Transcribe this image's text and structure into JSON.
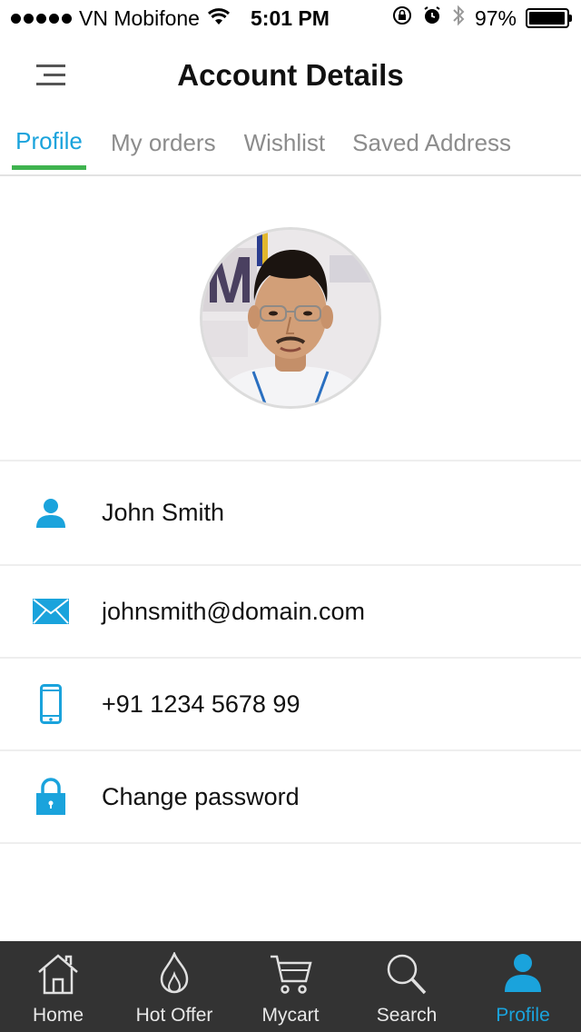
{
  "status_bar": {
    "carrier": "VN Mobifone",
    "time": "5:01 PM",
    "battery": "97%",
    "battery_level": 0.97
  },
  "header": {
    "title": "Account Details"
  },
  "tabs": [
    {
      "label": "Profile",
      "active": true
    },
    {
      "label": "My orders",
      "active": false
    },
    {
      "label": "Wishlist",
      "active": false
    },
    {
      "label": "Saved Address",
      "active": false
    }
  ],
  "profile": {
    "name": "John Smith",
    "email": "johnsmith@domain.com",
    "phone": "+91 1234 5678 99",
    "change_password": "Change password"
  },
  "bottom_nav": [
    {
      "label": "Home",
      "icon": "home-icon",
      "active": false
    },
    {
      "label": "Hot Offer",
      "icon": "flame-icon",
      "active": false
    },
    {
      "label": "Mycart",
      "icon": "cart-icon",
      "active": false
    },
    {
      "label": "Search",
      "icon": "search-icon",
      "active": false
    },
    {
      "label": "Profile",
      "icon": "user-icon",
      "active": true
    }
  ],
  "colors": {
    "accent": "#1aa3dc",
    "tab_indicator": "#3fb34f",
    "nav_background": "#333333"
  }
}
